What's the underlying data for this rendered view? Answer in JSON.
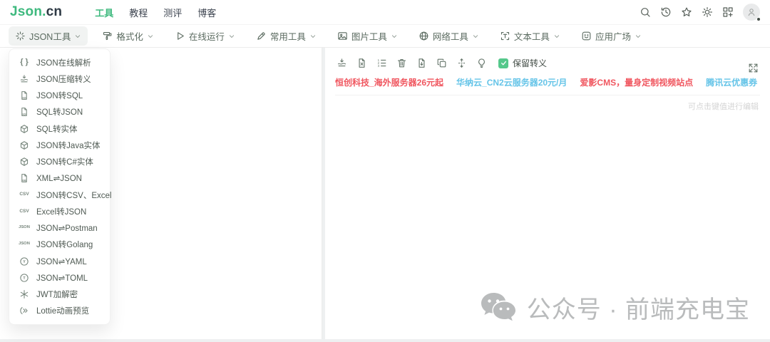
{
  "header": {
    "logo": {
      "primary": "Json.",
      "secondary": "cn"
    },
    "nav": [
      {
        "label": "工具",
        "active": true
      },
      {
        "label": "教程",
        "active": false
      },
      {
        "label": "测评",
        "active": false
      },
      {
        "label": "博客",
        "active": false
      }
    ],
    "actions": [
      "search-icon",
      "history-icon",
      "star-icon",
      "theme-icon",
      "qrcode-icon"
    ]
  },
  "toolbar": {
    "menus": [
      {
        "label": "JSON工具",
        "icon": "magic-icon",
        "active": true
      },
      {
        "label": "格式化",
        "icon": "format-icon",
        "active": false
      },
      {
        "label": "在线运行",
        "icon": "play-icon",
        "active": false
      },
      {
        "label": "常用工具",
        "icon": "pen-icon",
        "active": false
      },
      {
        "label": "图片工具",
        "icon": "image-icon",
        "active": false
      },
      {
        "label": "网络工具",
        "icon": "globe-icon",
        "active": false
      },
      {
        "label": "文本工具",
        "icon": "text-frame-icon",
        "active": false
      },
      {
        "label": "应用广场",
        "icon": "apps-icon",
        "active": false
      }
    ]
  },
  "dropdown": {
    "items": [
      {
        "label": "JSON在线解析",
        "icon": "braces-icon"
      },
      {
        "label": "JSON压缩转义",
        "icon": "compress-icon"
      },
      {
        "label": "JSON转SQL",
        "icon": "sql-file-icon"
      },
      {
        "label": "SQL转JSON",
        "icon": "sql-file-icon"
      },
      {
        "label": "SQL转实体",
        "icon": "cube-icon"
      },
      {
        "label": "JSON转Java实体",
        "icon": "cube-icon"
      },
      {
        "label": "JSON转C#实体",
        "icon": "cube-icon"
      },
      {
        "label": "XML⇌JSON",
        "icon": "xml-file-icon"
      },
      {
        "label": "JSON转CSV、Excel",
        "icon": "csv-icon"
      },
      {
        "label": "Excel转JSON",
        "icon": "csv-icon"
      },
      {
        "label": "JSON⇌Postman",
        "icon": "json-text-icon"
      },
      {
        "label": "JSON转Golang",
        "icon": "json-text-icon"
      },
      {
        "label": "JSON⇌YAML",
        "icon": "yaml-icon"
      },
      {
        "label": "JSON⇌TOML",
        "icon": "toml-icon"
      },
      {
        "label": "JWT加解密",
        "icon": "jwt-icon"
      },
      {
        "label": "Lottie动画预览",
        "icon": "lottie-icon"
      }
    ]
  },
  "result_panel": {
    "toolbar_icons": [
      "compress-icon",
      "file-remove-icon",
      "sort-list-icon",
      "trash-icon",
      "file-download-icon",
      "copy-icon",
      "expand-vertical-icon",
      "bulb-icon"
    ],
    "keep_escape_label": "保留转义",
    "keep_escape_checked": true,
    "fullscreen_icon": "fullscreen-icon",
    "promos": [
      {
        "text": "恒创科技_海外服务器26元起",
        "color": "#f0565f"
      },
      {
        "text": "华纳云_CN2云服务器20元/月",
        "color": "#65c4e8"
      },
      {
        "text": "爱影CMS，量身定制视频站点",
        "color": "#f0565f"
      },
      {
        "text": "腾讯云优惠券",
        "color": "#65c4e8"
      }
    ],
    "hint": "可点击键值进行编辑",
    "watermark": {
      "icon": "wechat-icon",
      "text": "公众号 · 前端充电宝"
    }
  },
  "colors": {
    "brand_green": "#3eb97e",
    "checkbox_green": "#55c88b",
    "promo_red": "#f0565f",
    "promo_blue": "#65c4e8"
  }
}
